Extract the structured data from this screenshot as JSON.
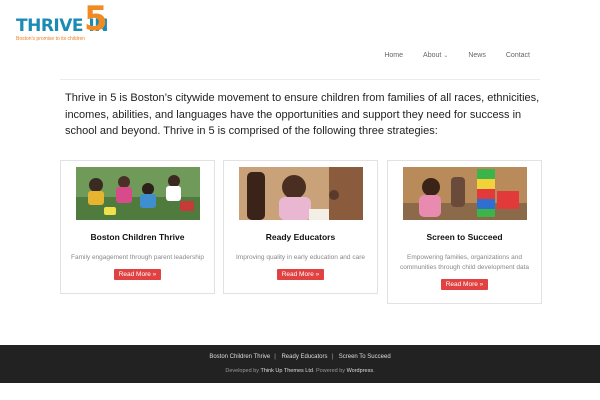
{
  "logo": {
    "word": "THRIVE IN",
    "number": "5",
    "tagline": "Boston's promise to its children"
  },
  "nav": {
    "items": [
      "Home",
      "About",
      "News",
      "Contact"
    ]
  },
  "intro": "Thrive in 5 is Boston’s citywide movement to ensure children from families of all races, ethnicities, incomes, abilities, and languages have the opportunities and support they need for success in school and beyond. Thrive in 5 is comprised of the following three strategies:",
  "cards": [
    {
      "title": "Boston Children Thrive",
      "desc": "Family engagement through parent leadership",
      "button": "Read More »"
    },
    {
      "title": "Ready Educators",
      "desc": "Improving quality in early education and care",
      "button": "Read More »"
    },
    {
      "title": "Screen to Succeed",
      "desc": "Empowering families, organizations and communities through child development data",
      "button": "Read More »"
    }
  ],
  "footer": {
    "links": [
      "Boston Children Thrive",
      "Ready Educators",
      "Screen To Succeed"
    ],
    "developed_by": "Developed by",
    "theme_name": "Think Up Themes Ltd",
    "powered_by": ". Powered by",
    "platform": "Wordpress",
    "end": "."
  },
  "colors": {
    "accent_red": "#e14141",
    "logo_blue": "#1b8bb5",
    "logo_orange": "#f18a21",
    "footer_bg": "#222222"
  },
  "icons": {
    "about_dropdown": "chevron-down-icon"
  }
}
